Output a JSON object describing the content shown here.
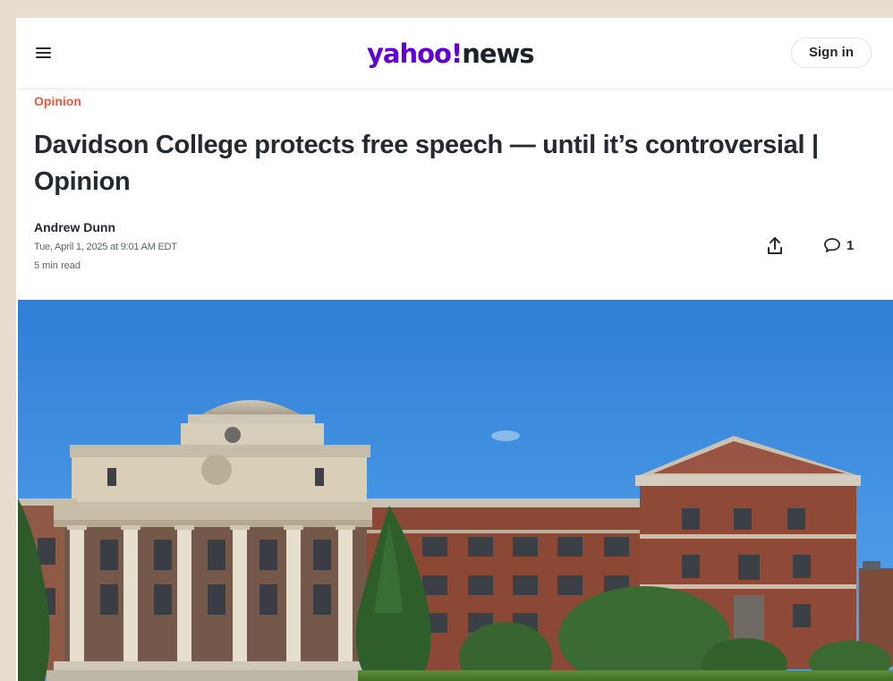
{
  "header": {
    "logo_brand": "yahoo",
    "logo_mark": "!",
    "logo_section": "news",
    "signin_label": "Sign in",
    "menu_icon": "hamburger-menu-icon"
  },
  "article": {
    "category": "Opinion",
    "headline": "Davidson College protects free speech — until it’s controversial | Opinion",
    "author": "Andrew Dunn",
    "date": "Tue, April 1, 2025 at 9:01 AM EDT",
    "read_time": "5 min read",
    "share_icon": "share-icon",
    "comment_icon": "comment-icon",
    "comment_count": "1"
  },
  "image": {
    "subject": "college-building-photo"
  },
  "colors": {
    "page_background": "#e8dccf",
    "brand_purple": "#6001d2",
    "category_orange": "#e9583b",
    "text_dark": "#232a31",
    "text_muted": "#5b636a",
    "sky_blue": "#3d8fe0",
    "brick": "#8f4a36",
    "stone": "#d8ccb6"
  }
}
